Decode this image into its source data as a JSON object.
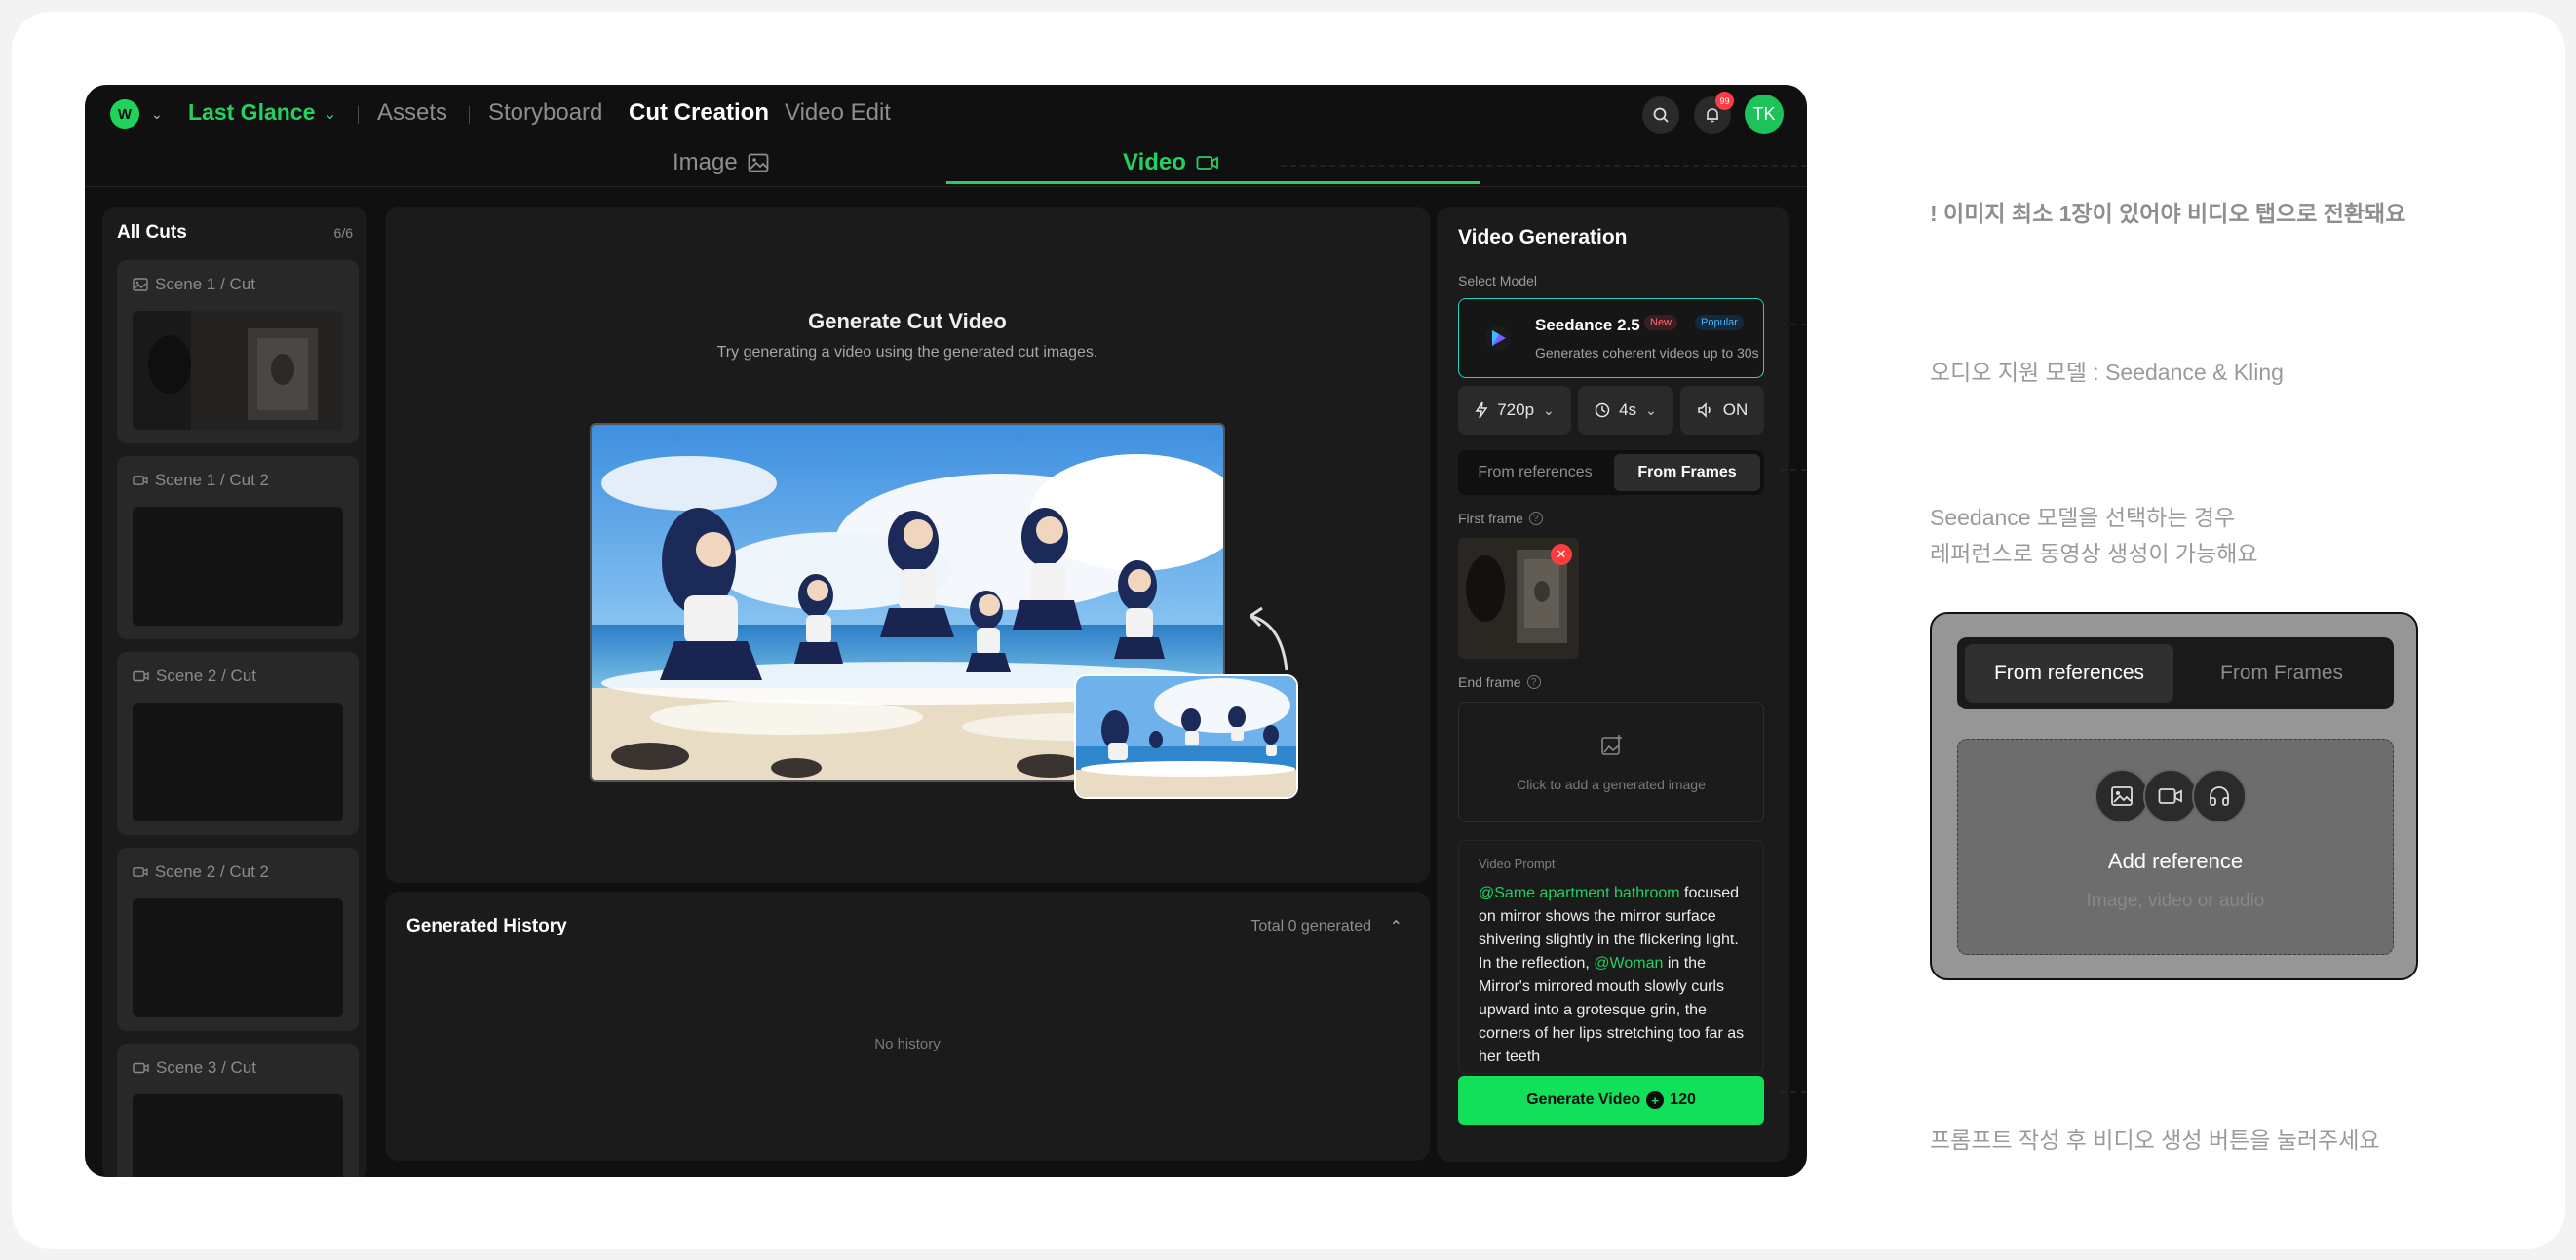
{
  "header": {
    "project_name": "Last Glance",
    "logo_text": "W",
    "nav": [
      "Assets",
      "Storyboard",
      "Cut Creation",
      "Video Edit"
    ],
    "notification_count": "99",
    "avatar_initials": "TK"
  },
  "tabs": {
    "image": "Image",
    "video": "Video"
  },
  "cuts_panel": {
    "title": "All Cuts",
    "count": "6/6",
    "items": [
      {
        "label": "Scene 1 / Cut",
        "kind": "image-icon"
      },
      {
        "label": "Scene 1 / Cut 2",
        "kind": "video-icon"
      },
      {
        "label": "Scene 2 / Cut",
        "kind": "video-icon"
      },
      {
        "label": "Scene 2 / Cut 2",
        "kind": "video-icon"
      },
      {
        "label": "Scene 3 / Cut",
        "kind": "video-icon"
      }
    ]
  },
  "main": {
    "title": "Generate Cut Video",
    "subtitle": "Try generating a video using the generated cut images."
  },
  "history": {
    "title": "Generated History",
    "total": "Total 0 generated",
    "empty": "No history"
  },
  "video_generation": {
    "title": "Video Generation",
    "select_model_label": "Select Model",
    "model": {
      "name": "Seedance 2.5",
      "tag_new": "New",
      "tag_popular": "Popular",
      "description": "Generates coherent videos up to 30s"
    },
    "resolution": "720p",
    "duration": "4s",
    "audio": "ON",
    "source_tabs": [
      "From references",
      "From Frames"
    ],
    "first_frame_label": "First frame",
    "end_frame_label": "End frame",
    "end_frame_hint": "Click to add a generated image",
    "prompt_label": "Video Prompt",
    "prompt": {
      "mention1": "@Same apartment bathroom",
      "text1": " focused on mirror shows the mirror surface shivering slightly in the flickering light. In the reflection, ",
      "mention2": "@Woman",
      "text2": " in the Mirror's mirrored mouth slowly curls upward into a grotesque grin, the corners of her lips stretching too far as her teeth"
    },
    "generate_label": "Generate Video",
    "cost": "120"
  },
  "annotations": {
    "note1": "! 이미지 최소 1장이 있어야 비디오 탭으로 전환돼요",
    "note2": "오디오 지원 모델 : Seedance & Kling",
    "note3_line1": "Seedance 모델을 선택하는 경우",
    "note3_line2": "레퍼런스로 동영상 생성이 가능해요",
    "note4": "프롬프트 작성 후 비디오 생성 버튼을 눌러주세요",
    "mock": {
      "tab_a": "From references",
      "tab_b": "From Frames",
      "title": "Add reference",
      "subtitle": "Image, video or audio"
    }
  },
  "colors": {
    "accent": "#22d160",
    "background": "#101010",
    "panel": "#1b1b1b",
    "model_border": "#1ed1c0",
    "badge": "#ff3b45"
  }
}
